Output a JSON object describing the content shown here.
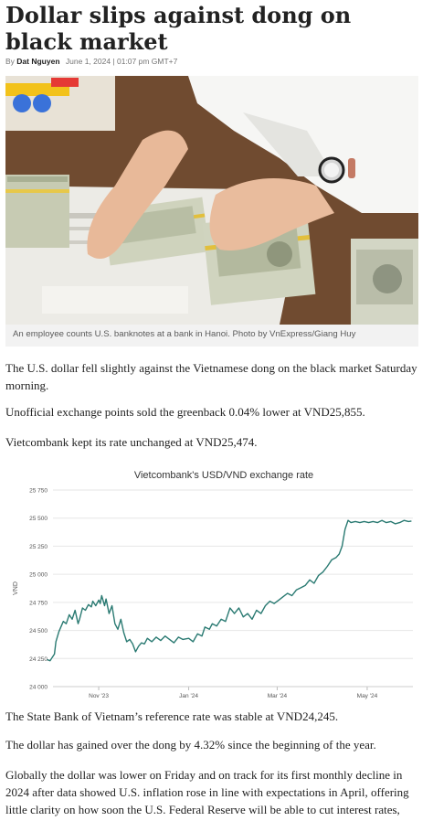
{
  "article": {
    "headline": "Dollar slips against dong on black market",
    "by_prefix": "By",
    "author": "Dat Nguyen",
    "date": "June 1, 2024 | 01:07 pm GMT+7"
  },
  "image": {
    "caption": "An employee counts U.S. banknotes at a bank in Hanoi. Photo by VnExpress/Giang Huy"
  },
  "paragraphs": [
    "The U.S. dollar fell slightly against the Vietnamese dong on the black market Saturday morning.",
    "Unofficial exchange points sold the greenback 0.04% lower at VND25,855.",
    "Vietcombank kept its rate unchanged at VND25,474.",
    "The State Bank of Vietnam’s reference rate was stable at VND24,245.",
    "The dollar has gained over the dong by 4.32% since the beginning of the year.",
    "Globally the dollar was lower on Friday and on track for its first monthly decline in 2024 after data showed U.S. inflation rose in line with expectations in April, offering little clarity on how soon the U.S. Federal Reserve will be able to cut interest rates,"
  ],
  "chart_data": {
    "type": "line",
    "title": "Vietcombank's USD/VND exchange rate",
    "ylabel": "VND",
    "xlabel": "",
    "ylim": [
      24000,
      25750
    ],
    "xlim": [
      "2023-10-01",
      "2024-06-01"
    ],
    "y_ticks": [
      24000,
      24250,
      24500,
      24750,
      25000,
      25250,
      25500,
      25750
    ],
    "y_tick_labels": [
      "24 000",
      "24 250",
      "24 500",
      "24 750",
      "25 000",
      "25 250",
      "25 500",
      "25 750"
    ],
    "x_ticks": [
      {
        "x": "2023-11-01",
        "label": "Nov '23"
      },
      {
        "x": "2024-01-01",
        "label": "Jan '24"
      },
      {
        "x": "2024-03-01",
        "label": "Mar '24"
      },
      {
        "x": "2024-05-01",
        "label": "May '24"
      }
    ],
    "grid": true,
    "color": "#2a7a72",
    "series": [
      {
        "name": "",
        "points": [
          [
            "2023-09-27",
            24240
          ],
          [
            "2023-09-29",
            24230
          ],
          [
            "2023-10-02",
            24290
          ],
          [
            "2023-10-03",
            24400
          ],
          [
            "2023-10-05",
            24490
          ],
          [
            "2023-10-08",
            24580
          ],
          [
            "2023-10-10",
            24560
          ],
          [
            "2023-10-12",
            24640
          ],
          [
            "2023-10-14",
            24600
          ],
          [
            "2023-10-16",
            24680
          ],
          [
            "2023-10-18",
            24560
          ],
          [
            "2023-10-19",
            24600
          ],
          [
            "2023-10-21",
            24700
          ],
          [
            "2023-10-23",
            24680
          ],
          [
            "2023-10-25",
            24730
          ],
          [
            "2023-10-27",
            24710
          ],
          [
            "2023-10-28",
            24760
          ],
          [
            "2023-10-30",
            24720
          ],
          [
            "2023-11-01",
            24770
          ],
          [
            "2023-11-02",
            24740
          ],
          [
            "2023-11-03",
            24810
          ],
          [
            "2023-11-05",
            24720
          ],
          [
            "2023-11-06",
            24780
          ],
          [
            "2023-11-08",
            24650
          ],
          [
            "2023-11-10",
            24720
          ],
          [
            "2023-11-12",
            24560
          ],
          [
            "2023-11-14",
            24510
          ],
          [
            "2023-11-16",
            24600
          ],
          [
            "2023-11-18",
            24480
          ],
          [
            "2023-11-20",
            24400
          ],
          [
            "2023-11-22",
            24420
          ],
          [
            "2023-11-24",
            24380
          ],
          [
            "2023-11-26",
            24310
          ],
          [
            "2023-11-28",
            24360
          ],
          [
            "2023-11-30",
            24390
          ],
          [
            "2023-12-02",
            24380
          ],
          [
            "2023-12-04",
            24430
          ],
          [
            "2023-12-07",
            24400
          ],
          [
            "2023-12-10",
            24440
          ],
          [
            "2023-12-13",
            24410
          ],
          [
            "2023-12-16",
            24450
          ],
          [
            "2023-12-19",
            24420
          ],
          [
            "2023-12-22",
            24390
          ],
          [
            "2023-12-25",
            24440
          ],
          [
            "2023-12-28",
            24420
          ],
          [
            "2024-01-01",
            24430
          ],
          [
            "2024-01-04",
            24400
          ],
          [
            "2024-01-07",
            24470
          ],
          [
            "2024-01-10",
            24450
          ],
          [
            "2024-01-12",
            24530
          ],
          [
            "2024-01-15",
            24510
          ],
          [
            "2024-01-17",
            24560
          ],
          [
            "2024-01-20",
            24540
          ],
          [
            "2024-01-23",
            24600
          ],
          [
            "2024-01-26",
            24580
          ],
          [
            "2024-01-29",
            24700
          ],
          [
            "2024-02-01",
            24650
          ],
          [
            "2024-02-04",
            24700
          ],
          [
            "2024-02-07",
            24620
          ],
          [
            "2024-02-10",
            24650
          ],
          [
            "2024-02-13",
            24600
          ],
          [
            "2024-02-16",
            24680
          ],
          [
            "2024-02-19",
            24650
          ],
          [
            "2024-02-22",
            24720
          ],
          [
            "2024-02-25",
            24760
          ],
          [
            "2024-02-28",
            24740
          ],
          [
            "2024-03-02",
            24770
          ],
          [
            "2024-03-05",
            24800
          ],
          [
            "2024-03-08",
            24830
          ],
          [
            "2024-03-11",
            24810
          ],
          [
            "2024-03-14",
            24860
          ],
          [
            "2024-03-17",
            24880
          ],
          [
            "2024-03-20",
            24900
          ],
          [
            "2024-03-23",
            24950
          ],
          [
            "2024-03-26",
            24920
          ],
          [
            "2024-03-29",
            24990
          ],
          [
            "2024-04-01",
            25020
          ],
          [
            "2024-04-04",
            25070
          ],
          [
            "2024-04-07",
            25130
          ],
          [
            "2024-04-10",
            25150
          ],
          [
            "2024-04-12",
            25180
          ],
          [
            "2024-04-14",
            25250
          ],
          [
            "2024-04-16",
            25400
          ],
          [
            "2024-04-18",
            25480
          ],
          [
            "2024-04-20",
            25460
          ],
          [
            "2024-04-23",
            25470
          ],
          [
            "2024-04-26",
            25460
          ],
          [
            "2024-04-29",
            25470
          ],
          [
            "2024-05-02",
            25460
          ],
          [
            "2024-05-05",
            25470
          ],
          [
            "2024-05-08",
            25460
          ],
          [
            "2024-05-11",
            25480
          ],
          [
            "2024-05-14",
            25460
          ],
          [
            "2024-05-17",
            25470
          ],
          [
            "2024-05-20",
            25450
          ],
          [
            "2024-05-23",
            25460
          ],
          [
            "2024-05-26",
            25480
          ],
          [
            "2024-05-29",
            25470
          ],
          [
            "2024-05-31",
            25474
          ]
        ]
      }
    ]
  }
}
